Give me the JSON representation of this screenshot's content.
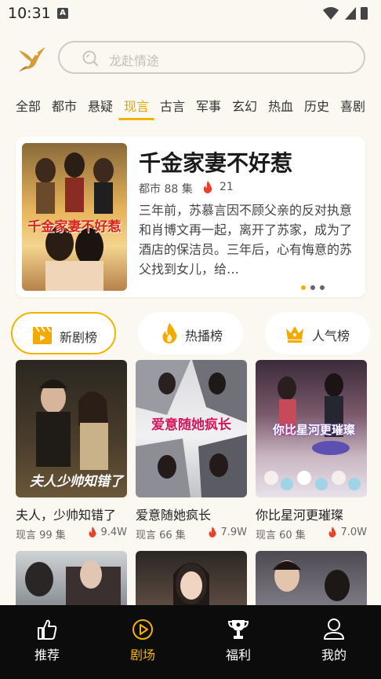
{
  "status": {
    "time": "10:31",
    "indicator": "A"
  },
  "search": {
    "placeholder": "龙赴情途"
  },
  "categories": [
    "全部",
    "都市",
    "悬疑",
    "现言",
    "古言",
    "军事",
    "玄幻",
    "热血",
    "历史",
    "喜剧"
  ],
  "active_category": "现言",
  "featured": {
    "title": "千金家妻不好惹",
    "genre_episodes": "都市 88 集",
    "heat": "21",
    "poster_text": "千金家妻不好惹",
    "description": "三年前，苏慕言因不顾父亲的反对执意和肖博文再一起，离开了苏家，成为了酒店的保洁员。三年后，心有悔意的苏父找到女儿，给…"
  },
  "rank_tabs": [
    {
      "label": "新剧榜",
      "icon": "clapperboard-icon",
      "active": true
    },
    {
      "label": "热播榜",
      "icon": "flame-icon",
      "active": false
    },
    {
      "label": "人气榜",
      "icon": "crown-icon",
      "active": false
    }
  ],
  "dramas": [
    {
      "title": "夫人，少帅知错了",
      "meta": "现言 99 集",
      "heat": "9.4W",
      "poster_text": "夫人少帅知错了"
    },
    {
      "title": "爱意随她疯长",
      "meta": "现言 66 集",
      "heat": "7.9W",
      "poster_text": "爱意随她疯长"
    },
    {
      "title": "你比星河更璀璨",
      "meta": "现言 60 集",
      "heat": "7.0W",
      "poster_text": "你比星河更璀璨"
    }
  ],
  "nav": [
    {
      "label": "推荐",
      "icon": "thumbs-up-icon",
      "active": false
    },
    {
      "label": "剧场",
      "icon": "play-circle-icon",
      "active": true
    },
    {
      "label": "福利",
      "icon": "trophy-icon",
      "active": false
    },
    {
      "label": "我的",
      "icon": "user-icon",
      "active": false
    }
  ],
  "colors": {
    "accent": "#f2b300",
    "fire": "#e8412c",
    "background": "#fbf8f1",
    "nav_bg": "#0c0c0c"
  }
}
